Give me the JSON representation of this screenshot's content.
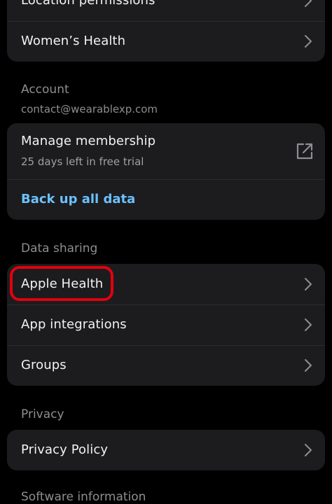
{
  "top_group": {
    "items": [
      {
        "label": "Location permissions"
      },
      {
        "label": "Women’s Health"
      }
    ]
  },
  "account": {
    "title": "Account",
    "email": "contact@wearablexp.com",
    "manage_membership": {
      "label": "Manage membership",
      "sublabel": "25 days left in free trial",
      "icon": "external-link-icon"
    },
    "backup_label": "Back up all data"
  },
  "data_sharing": {
    "title": "Data sharing",
    "items": [
      {
        "label": "Apple Health"
      },
      {
        "label": "App integrations"
      },
      {
        "label": "Groups"
      }
    ]
  },
  "privacy": {
    "title": "Privacy",
    "items": [
      {
        "label": "Privacy Policy"
      }
    ]
  },
  "software": {
    "title": "Software information"
  },
  "colors": {
    "background": "#000000",
    "card": "#1c1c1e",
    "link": "#6cc1ff",
    "highlight": "#e3000f",
    "chevron": "#8e8e93"
  }
}
